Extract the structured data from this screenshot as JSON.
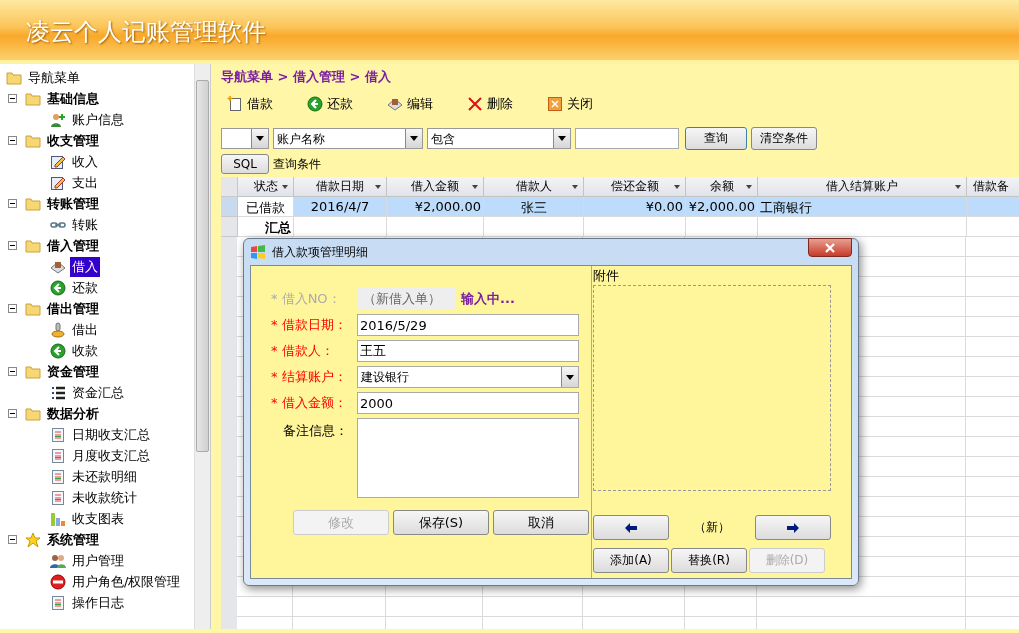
{
  "app_title": "凌云个人记账管理软件",
  "sidebar": {
    "root": "导航菜单",
    "groups": [
      {
        "label": "基础信息",
        "kind": "folder",
        "expanded": true,
        "children": [
          {
            "label": "账户信息",
            "kind": "user-add",
            "selected": false
          }
        ]
      },
      {
        "label": "收支管理",
        "kind": "folder",
        "expanded": true,
        "children": [
          {
            "label": "收入",
            "kind": "edit",
            "selected": false
          },
          {
            "label": "支出",
            "kind": "edit",
            "selected": false
          }
        ]
      },
      {
        "label": "转账管理",
        "kind": "folder",
        "expanded": true,
        "children": [
          {
            "label": "转账",
            "kind": "link",
            "selected": false
          }
        ]
      },
      {
        "label": "借入管理",
        "kind": "folder",
        "expanded": true,
        "children": [
          {
            "label": "借入",
            "kind": "stamp",
            "selected": true
          },
          {
            "label": "还款",
            "kind": "back",
            "selected": false
          }
        ]
      },
      {
        "label": "借出管理",
        "kind": "folder",
        "expanded": true,
        "children": [
          {
            "label": "借出",
            "kind": "coin",
            "selected": false
          },
          {
            "label": "收款",
            "kind": "back",
            "selected": false
          }
        ]
      },
      {
        "label": "资金管理",
        "kind": "folder",
        "expanded": true,
        "children": [
          {
            "label": "资金汇总",
            "kind": "list",
            "selected": false
          }
        ]
      },
      {
        "label": "数据分析",
        "kind": "folder",
        "expanded": true,
        "children": [
          {
            "label": "日期收支汇总",
            "kind": "report",
            "selected": false
          },
          {
            "label": "月度收支汇总",
            "kind": "report",
            "selected": false
          },
          {
            "label": "未还款明细",
            "kind": "report",
            "selected": false
          },
          {
            "label": "未收款统计",
            "kind": "report",
            "selected": false
          },
          {
            "label": "收支图表",
            "kind": "chart",
            "selected": false
          }
        ]
      },
      {
        "label": "系统管理",
        "kind": "star",
        "expanded": true,
        "children": [
          {
            "label": "用户管理",
            "kind": "users",
            "selected": false
          },
          {
            "label": "用户角色/权限管理",
            "kind": "forbid",
            "selected": false
          },
          {
            "label": "操作日志",
            "kind": "report",
            "selected": false
          }
        ]
      }
    ]
  },
  "breadcrumb": "导航菜单 > 借入管理 > 借入",
  "toolbar": [
    {
      "label": "借款",
      "kind": "new"
    },
    {
      "label": "还款",
      "kind": "back"
    },
    {
      "label": "编辑",
      "kind": "edit"
    },
    {
      "label": "删除",
      "kind": "delete"
    },
    {
      "label": "关闭",
      "kind": "close"
    }
  ],
  "filter": {
    "field": "账户名称",
    "operator": "包含",
    "query_button": "查询",
    "clear_button": "清空条件",
    "sql_button": "SQL",
    "condition_text": "查询条件"
  },
  "table": {
    "columns": [
      "状态",
      "借款日期",
      "借入金额",
      "借款人",
      "偿还金额",
      "余额",
      "借入结算账户",
      "借款备"
    ],
    "rows": [
      {
        "selected": true,
        "cells": [
          "已借款",
          "2016/4/7",
          "¥2,000.00",
          "张三",
          "¥0.00",
          "¥2,000.00",
          "工商银行"
        ]
      }
    ],
    "summary_label": "汇总"
  },
  "dialog": {
    "title": "借入款项管理明细",
    "no_label": "* 借入NO：",
    "no_value": "（新借入单）",
    "status": "输入中...",
    "fields": [
      {
        "label": "* 借款日期：",
        "kind": "text",
        "required": true,
        "value": "2016/5/29"
      },
      {
        "label": "* 借款人：",
        "kind": "text",
        "required": true,
        "value": "王五"
      },
      {
        "label": "* 结算账户：",
        "kind": "select",
        "required": true,
        "value": "建设银行"
      },
      {
        "label": "* 借入金额：",
        "kind": "text",
        "required": true,
        "value": "2000"
      },
      {
        "label": "备注信息：",
        "kind": "textarea",
        "required": false
      }
    ],
    "buttons": [
      {
        "label": "修改",
        "disabled": true
      },
      {
        "label": "保存(S)",
        "disabled": false
      },
      {
        "label": "取消",
        "disabled": false
      }
    ],
    "attachment": {
      "title": "附件",
      "page_label": "（新）",
      "buttons": [
        {
          "label": "添加(A)",
          "disabled": false
        },
        {
          "label": "替换(R)",
          "disabled": false
        },
        {
          "label": "删除(D)",
          "disabled": true
        }
      ]
    }
  }
}
